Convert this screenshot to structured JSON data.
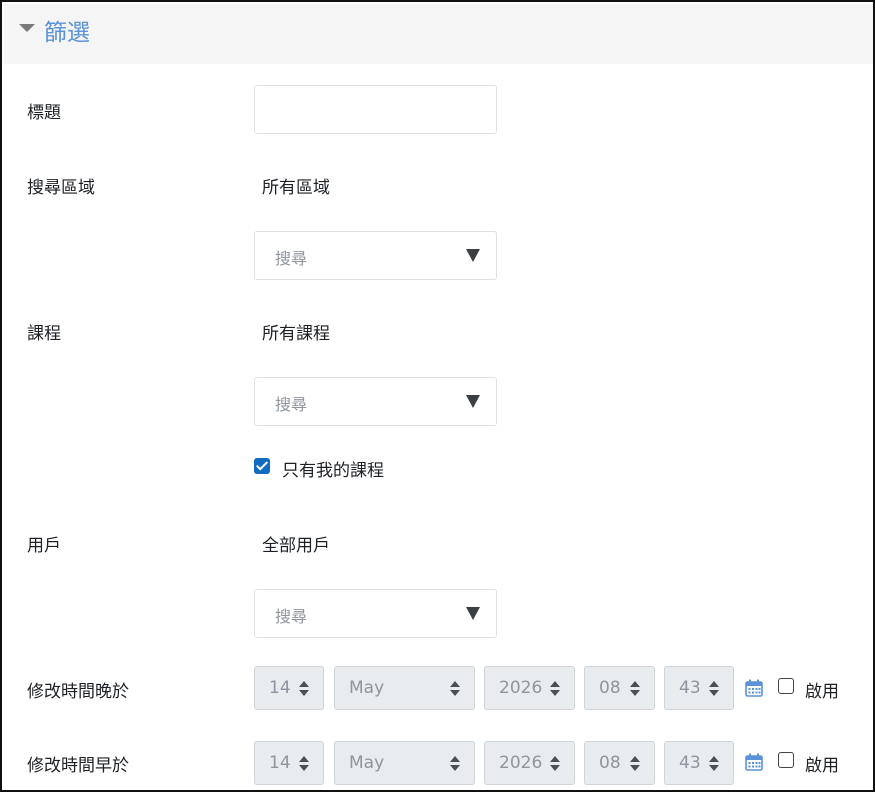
{
  "section": {
    "title": "篩選"
  },
  "fields": {
    "title": {
      "label": "標題",
      "value": ""
    },
    "search_area": {
      "label": "搜尋區域",
      "selected": "所有區域",
      "placeholder": "搜尋"
    },
    "course": {
      "label": "課程",
      "selected": "所有課程",
      "placeholder": "搜尋",
      "only_my_courses": {
        "label": "只有我的課程",
        "checked": true
      }
    },
    "user": {
      "label": "用戶",
      "selected": "全部用戶",
      "placeholder": "搜尋"
    },
    "modified_after": {
      "label": "修改時間晚於",
      "day": "14",
      "month": "May",
      "year": "2026",
      "hour": "08",
      "minute": "43",
      "enable_label": "啟用",
      "enabled": false
    },
    "modified_before": {
      "label": "修改時間早於",
      "day": "14",
      "month": "May",
      "year": "2026",
      "hour": "08",
      "minute": "43",
      "enable_label": "啟用",
      "enabled": false
    }
  },
  "colors": {
    "accent": "#5a93d8",
    "checkbox": "#0f6cbf",
    "calendar_icon": "#5a93d8",
    "disabled_select_bg": "#e9ecef"
  },
  "icons": {
    "collapse": "caret-down-icon",
    "dropdown": "triangle-down-icon",
    "calendar": "calendar-icon"
  }
}
